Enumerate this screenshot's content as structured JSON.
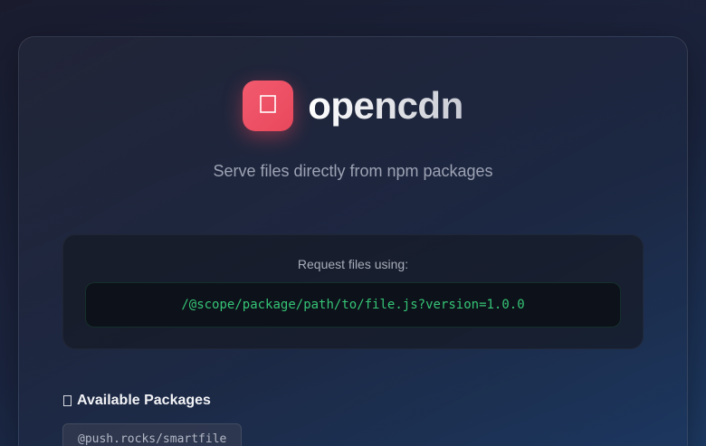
{
  "brand": {
    "name": "opencdn",
    "logo_icon": "package-icon"
  },
  "tagline": "Serve files directly from npm packages",
  "usage": {
    "label": "Request files using:",
    "example": "/@scope/package/path/to/file.js?version=1.0.0"
  },
  "packages_section": {
    "icon": "package-icon",
    "title": "Available Packages",
    "items": [
      {
        "name": "@push.rocks/smartfile"
      }
    ]
  },
  "colors": {
    "accent": "#e9485c",
    "code_text": "#35c476",
    "background_start": "#1a1c2e",
    "background_end": "#1d3a63"
  }
}
